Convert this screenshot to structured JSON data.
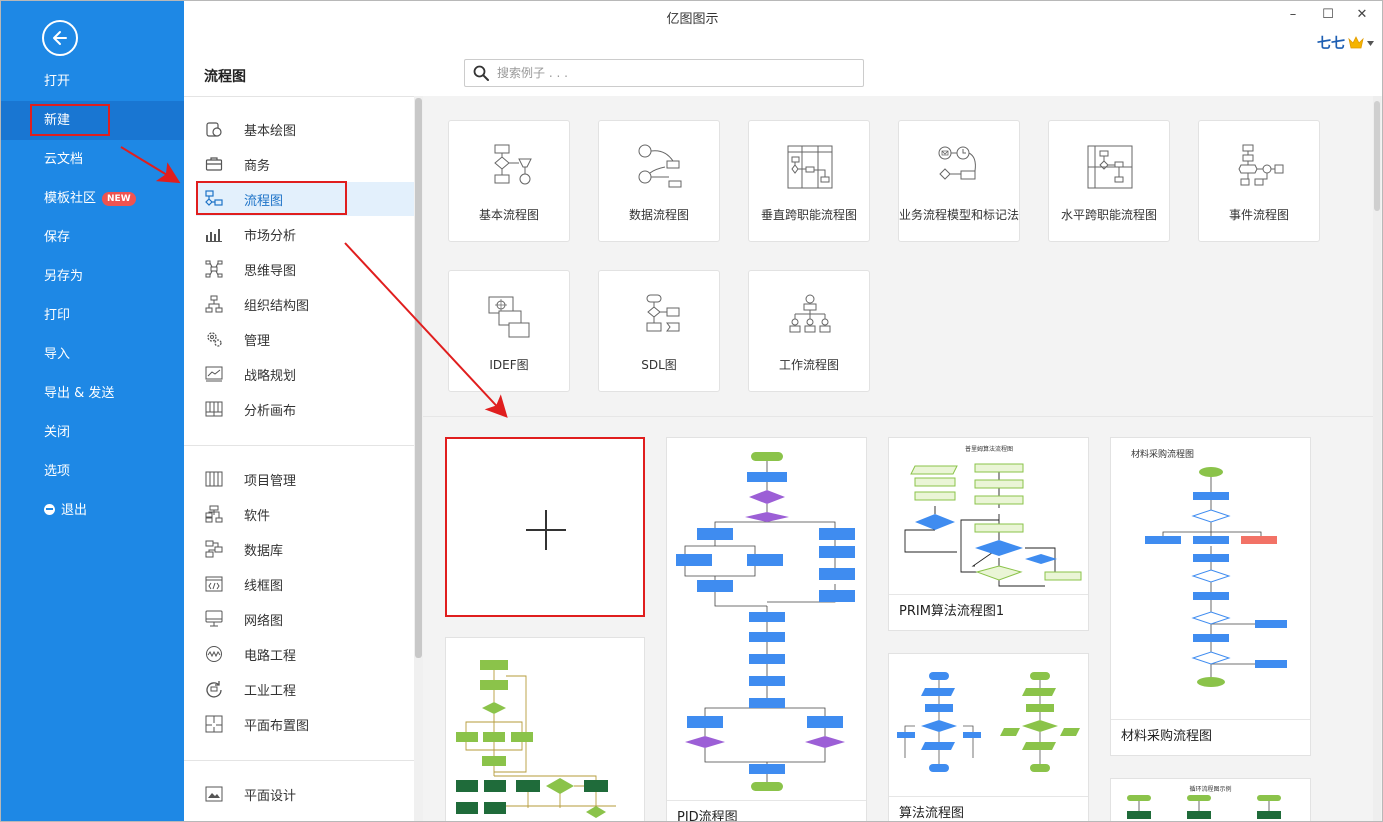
{
  "app": {
    "title": "亿图图示",
    "user_name": "七七"
  },
  "window": {
    "minimize": "–",
    "maximize": "☐",
    "close": "✕"
  },
  "nav": {
    "items": [
      {
        "label": "打开"
      },
      {
        "label": "新建",
        "active": true
      },
      {
        "label": "云文档"
      },
      {
        "label": "模板社区",
        "badge": "NEW"
      },
      {
        "label": "保存"
      },
      {
        "label": "另存为"
      },
      {
        "label": "打印"
      },
      {
        "label": "导入"
      },
      {
        "label": "导出 & 发送"
      },
      {
        "label": "关闭"
      },
      {
        "label": "选项"
      },
      {
        "label": "退出"
      }
    ]
  },
  "header": {
    "section_title": "流程图",
    "search_placeholder": "搜索例子 . . ."
  },
  "categories": {
    "group1": [
      "基本绘图",
      "商务",
      "流程图",
      "市场分析",
      "思维导图",
      "组织结构图",
      "管理",
      "战略规划",
      "分析画布"
    ],
    "group2": [
      "项目管理",
      "软件",
      "数据库",
      "线框图",
      "网络图",
      "电路工程",
      "工业工程",
      "平面布置图"
    ],
    "group3": [
      "平面设计"
    ],
    "active": "流程图"
  },
  "diagram_types": [
    "基本流程图",
    "数据流程图",
    "垂直跨职能流程图",
    "业务流程模型和标记法",
    "水平跨职能流程图",
    "事件流程图",
    "IDEF图",
    "SDL图",
    "工作流程图"
  ],
  "templates": {
    "pid": {
      "name": "PID流程图"
    },
    "prim": {
      "name": "PRIM算法流程图1",
      "thumb_title": "普里姆算法流程图"
    },
    "algo": {
      "name": "算法流程图"
    },
    "material": {
      "name": "材料采购流程图",
      "thumb_title": "材料采购流程图"
    },
    "extra": {
      "thumb_title": "循环流程图示例"
    }
  },
  "colors": {
    "nav_bg": "#1e88e5",
    "accent_red": "#e01e1e",
    "active_bg": "#e3f0fc"
  }
}
